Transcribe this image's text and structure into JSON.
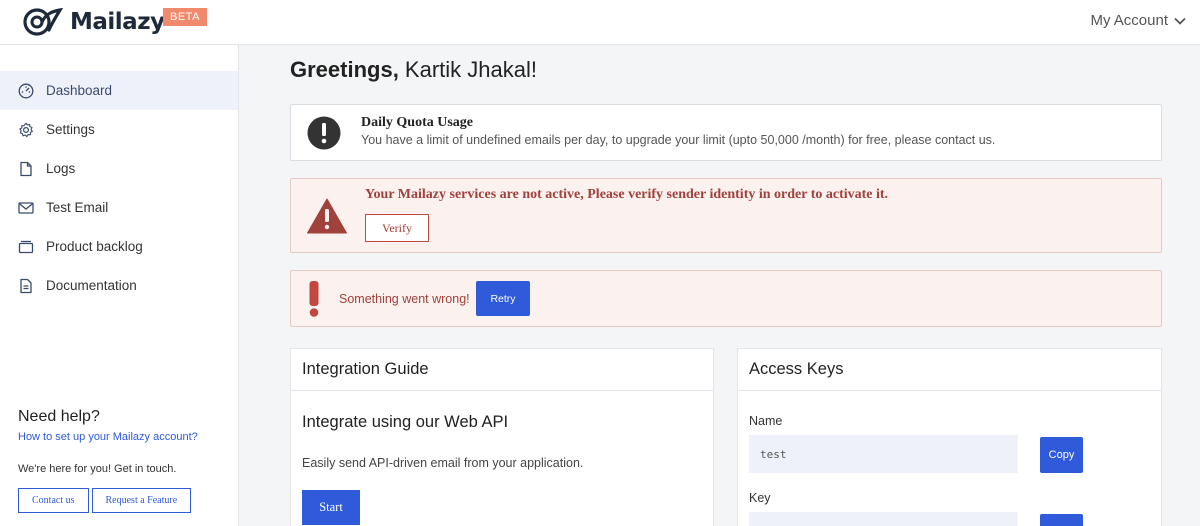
{
  "header": {
    "logo_text": "Mailazy",
    "beta_label": "BETA",
    "account_label": "My Account",
    "brand_color": "#1e2a3a",
    "accent_color": "#2f5ad9"
  },
  "sidebar": {
    "items": [
      {
        "label": "Dashboard",
        "icon": "dashboard-icon",
        "active": true
      },
      {
        "label": "Settings",
        "icon": "gear-icon"
      },
      {
        "label": "Logs",
        "icon": "document-icon"
      },
      {
        "label": "Test Email",
        "icon": "envelope-icon"
      },
      {
        "label": "Product backlog",
        "icon": "box-icon"
      },
      {
        "label": "Documentation",
        "icon": "file-text-icon"
      }
    ],
    "help": {
      "title": "Need help?",
      "link": "How to set up your Mailazy account?",
      "text": "We're here for you! Get in touch.",
      "contact_label": "Contact us",
      "feature_label": "Request a Feature"
    }
  },
  "main": {
    "greeting_prefix": "Greetings,",
    "greeting_name": " Kartik Jhakal!",
    "quota": {
      "title": "Daily Quota Usage",
      "text": "You have a limit of undefined emails per day, to upgrade your limit (upto 50,000 /month) for free, please contact us."
    },
    "alert": {
      "title": "Your Mailazy services are not active, Please verify sender identity in order to activate it.",
      "button": "Verify",
      "color": "#a0413b"
    },
    "error": {
      "text": "Something went wrong!",
      "button": "Retry"
    },
    "integration": {
      "title": "Integration Guide",
      "subtitle": "Integrate using our Web API",
      "text": "Easily send API-driven email from your application.",
      "button": "Start"
    },
    "access_keys": {
      "title": "Access Keys",
      "name_label": "Name",
      "name_value": "test",
      "copy_label": "Copy",
      "key_label": "Key"
    }
  }
}
